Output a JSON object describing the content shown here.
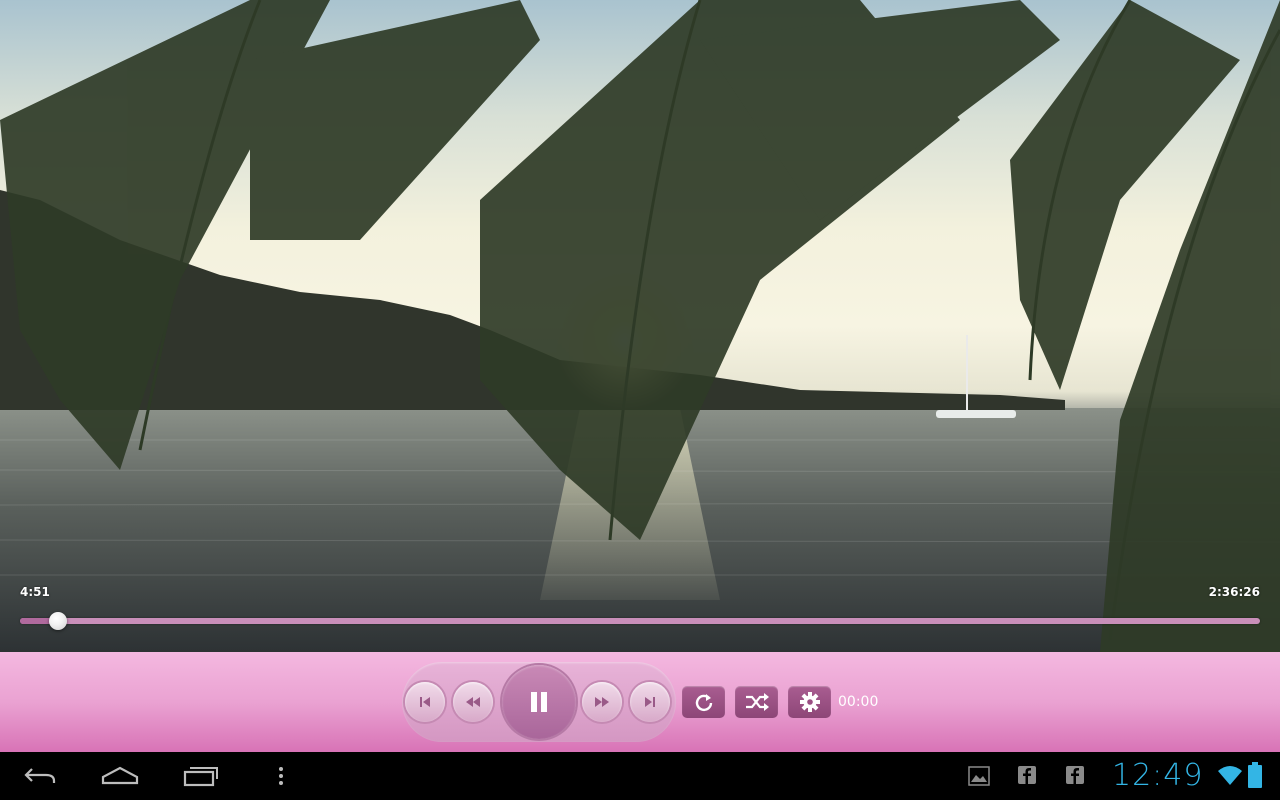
{
  "video": {
    "elapsed": "4:51",
    "duration": "2:36:26",
    "progress": 0.031
  },
  "controls": {
    "timer": "00:00",
    "buttons": [
      "skip-previous",
      "rewind",
      "pause",
      "fast-forward",
      "skip-next",
      "repeat",
      "shuffle",
      "settings"
    ]
  },
  "theme": {
    "accent": "#d873b6",
    "seek_track": "#c98fb9",
    "square_button": "#a95d91",
    "clock_color": "#33b5e5"
  },
  "system_bar": {
    "clock": "12:49",
    "nav_icons": [
      "back-icon",
      "home-icon",
      "recent-apps-icon",
      "menu-overflow-icon"
    ],
    "notification_icons": [
      "gallery-icon",
      "facebook-icon",
      "facebook-icon"
    ],
    "status_icons": [
      "wifi-icon",
      "battery-icon"
    ]
  }
}
